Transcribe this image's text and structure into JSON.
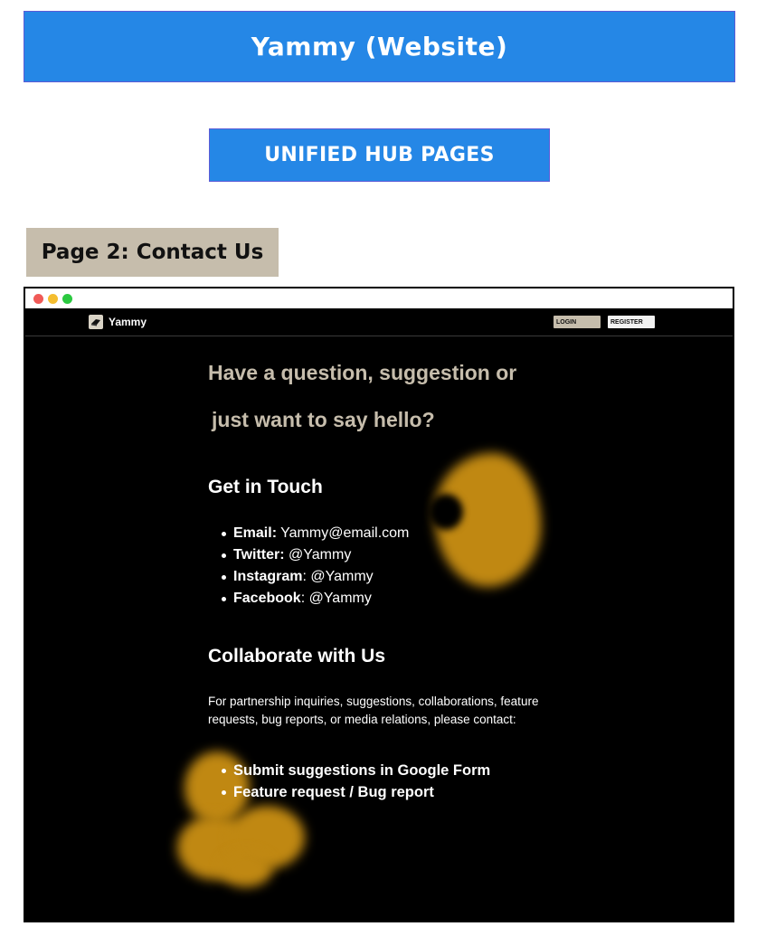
{
  "header": {
    "title": "Yammy (Website)",
    "subtitle": "UNIFIED HUB PAGES",
    "page_label": "Page 2: Contact Us"
  },
  "site": {
    "brand": "Yammy",
    "login_label": "LOGIN",
    "register_label": "REGISTER",
    "heading_line1": "Have a question, suggestion or",
    "heading_line2": "just want to say hello?",
    "contact": {
      "title": "Get in Touch",
      "items": [
        {
          "label": "Email:",
          "value": " Yammy@email.com"
        },
        {
          "label": "Twitter:",
          "value": " @Yammy"
        },
        {
          "label": "Instagram",
          "value": ": @Yammy"
        },
        {
          "label": "Facebook",
          "value": ": @Yammy"
        }
      ]
    },
    "collaborate": {
      "title": "Collaborate with Us",
      "description": "For partnership inquiries, suggestions, collaborations, feature requests, bug reports, or media relations, please contact:",
      "links": [
        "Submit suggestions in Google Form",
        "Feature request / Bug report"
      ]
    }
  },
  "colors": {
    "banner": "#2587e6",
    "page_label_bg": "#c6bdac",
    "site_bg": "#000000",
    "heading_accent": "#c6bdac",
    "blob": "#c08812"
  }
}
